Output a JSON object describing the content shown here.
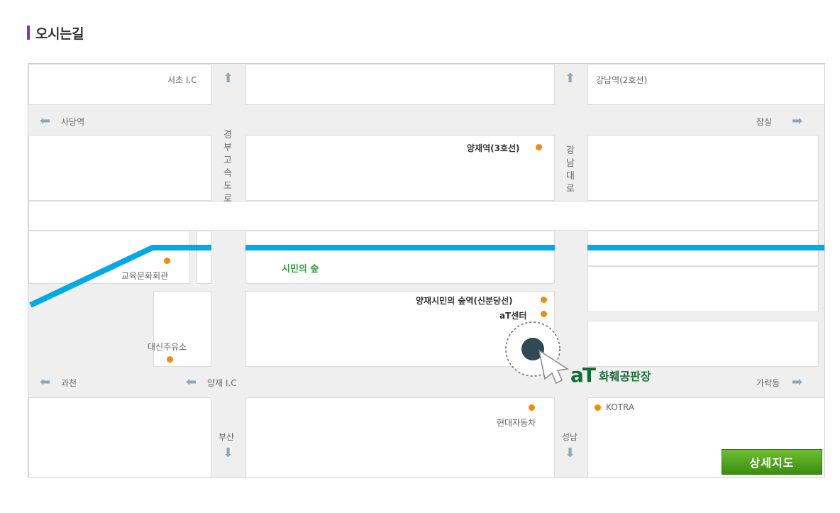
{
  "section": {
    "title": "오시는길",
    "accent_color": "#8b2fc9"
  },
  "map": {
    "road_labels": {
      "seocho_ic": "서초 I.C",
      "gangnam_station": "강남역(2호선)",
      "sadang": "사당역",
      "jamsil": "잠실",
      "gyeongbu_expressway": "경부고속도로",
      "gangnam_daero": "강남대로",
      "gwacheon": "과천",
      "yangjae_ic": "양재 I.C",
      "garakdong": "가락동",
      "busan": "부산",
      "seongnam": "성남"
    },
    "pois": {
      "yangjae_station": "양재역(3호선)",
      "education_center": "교육문화회관",
      "citizens_forest": "시민의 숲",
      "yangjae_forest_station": "양재시민의 숲역(신분당선)",
      "at_center": "aT센터",
      "gas_station": "대신주유소",
      "hyundai_motors": "현대자동차",
      "kotra": "KOTRA"
    },
    "logo": {
      "mark_a": "a",
      "mark_t": "T",
      "name": "화훼공판장"
    },
    "detail_button": "상세지도",
    "line_color": "#00aae7",
    "poi_color": "#f08a10"
  }
}
